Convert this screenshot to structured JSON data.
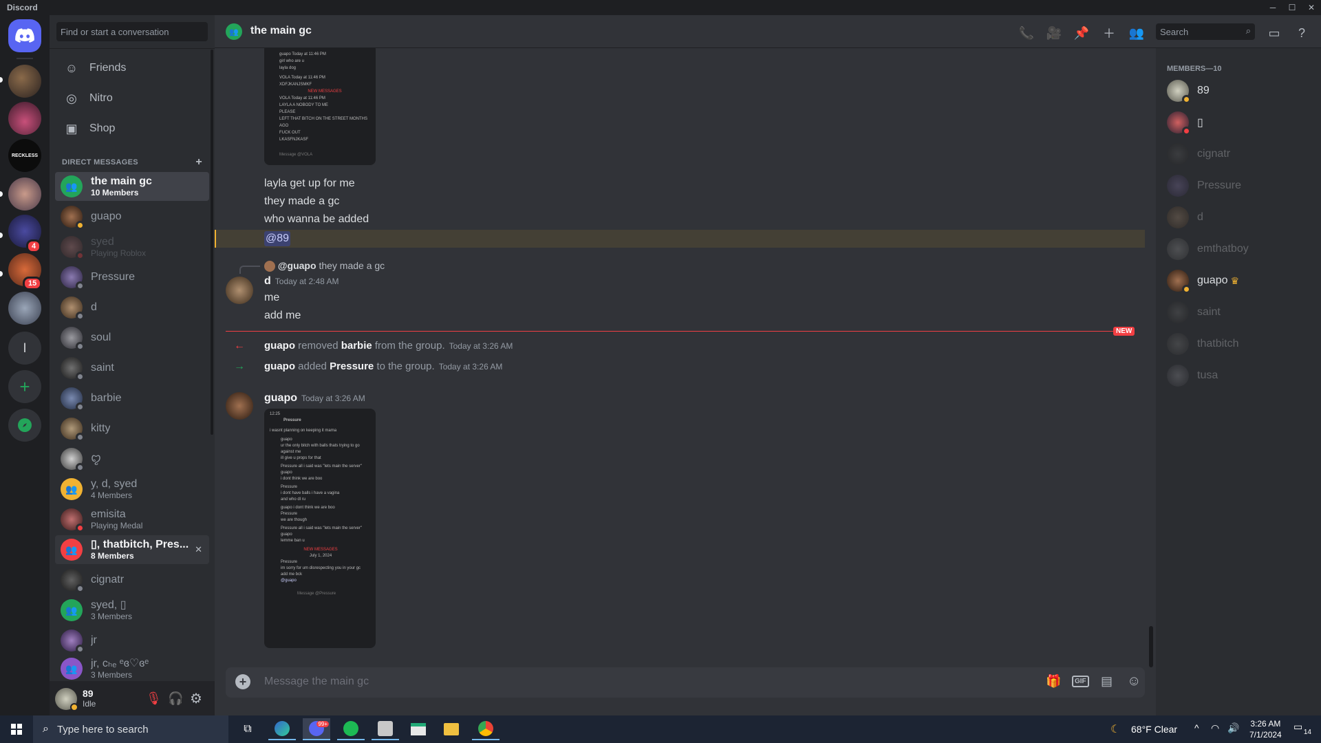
{
  "app": {
    "title": "Discord"
  },
  "search": {
    "dm_placeholder": "Find or start a conversation",
    "header_placeholder": "Search"
  },
  "nav": {
    "friends": "Friends",
    "nitro": "Nitro",
    "shop": "Shop"
  },
  "dm_section": {
    "title": "DIRECT MESSAGES",
    "add": "+"
  },
  "dms": [
    {
      "name": "the main gc",
      "sub": "10 Members"
    },
    {
      "name": "guapo",
      "sub": ""
    },
    {
      "name": "syed",
      "sub": "Playing Roblox"
    },
    {
      "name": "Pressure",
      "sub": ""
    },
    {
      "name": "d",
      "sub": ""
    },
    {
      "name": "soul",
      "sub": ""
    },
    {
      "name": "saint",
      "sub": ""
    },
    {
      "name": "barbie",
      "sub": ""
    },
    {
      "name": "kitty",
      "sub": ""
    },
    {
      "name": "ꨄ",
      "sub": ""
    },
    {
      "name": "y, d, syed",
      "sub": "4 Members"
    },
    {
      "name": "emisita",
      "sub": "Playing Medal"
    },
    {
      "name": "▯, thatbitch, Pres...",
      "sub": "8 Members",
      "close": "✕"
    },
    {
      "name": "cignatr",
      "sub": ""
    },
    {
      "name": "syed, ▯",
      "sub": "3 Members"
    },
    {
      "name": "jr",
      "sub": ""
    },
    {
      "name": "jr, ᴄₕₑ ᵉɞ♡ɞᵉ",
      "sub": "3 Members"
    }
  ],
  "servers": {
    "badges": [
      "4",
      "15"
    ],
    "letter": "l",
    "plus": "+"
  },
  "user": {
    "name": "89",
    "status": "Idle"
  },
  "header": {
    "channel": "the main gc"
  },
  "chat": {
    "lines1": [
      "layla get up for me",
      "they made a gc",
      "who wanna be added"
    ],
    "mention": "@89",
    "reply": {
      "author": "@guapo",
      "text": "they made a gc"
    },
    "msg_d": {
      "author": "d",
      "time": "Today at 2:48 AM",
      "lines": [
        "me",
        "add me"
      ]
    },
    "new_label": "NEW",
    "system": [
      {
        "actor": "guapo",
        "action": "removed",
        "target": "barbie",
        "rest": "from the group.",
        "time": "Today at 3:26 AM"
      },
      {
        "actor": "guapo",
        "action": "added",
        "target": "Pressure",
        "rest": "to the group.",
        "time": "Today at 3:26 AM"
      }
    ],
    "msg_guapo": {
      "author": "guapo",
      "time": "Today at 3:26 AM"
    },
    "shot1": {
      "lines": [
        "guapo  Today at 11:46 PM",
        "girl who are u",
        "layla dog",
        "VOLA  Today at 11:46 PM",
        "XDFJKANJSMKF",
        "NEW MESSAGES",
        "VOLA  Today at 11:46 PM",
        "LAYLA A NOBODY TO ME",
        "PLEASE",
        "LEFT THAT BITCH ON THE STREET MONTHS AGO",
        "FUCK OUT",
        "LKASFNJKASF",
        "Message @VOLA"
      ]
    },
    "shot2": {
      "lines": [
        "12:25",
        "Pressure",
        "i wasnt planning on keeping it mama",
        "guapo",
        "ur the only bitch with balls thats trying to go",
        "against me",
        "ill give u props for that",
        "Pressure  all i said was \"lets main the server\"",
        "guapo",
        "i dont think we are boo",
        "Pressure",
        "i dont have balls i have a vagina",
        "and who dl ru",
        "guapo i dont think we are boo",
        "Pressure",
        "we are though",
        "Pressure  all i said was \"lets main the server\"",
        "guapo",
        "lemme ban u",
        "NEW MESSAGES",
        "July 1, 2024",
        "Pressure",
        "im sorry for um disrespecting you in your gc",
        "add me bck",
        "@guapo",
        "Message @Pressure"
      ]
    },
    "input_placeholder": "Message the main gc"
  },
  "members": {
    "title": "MEMBERS—10",
    "list": [
      {
        "name": "89"
      },
      {
        "name": "▯"
      },
      {
        "name": "cignatr"
      },
      {
        "name": "Pressure"
      },
      {
        "name": "d"
      },
      {
        "name": "emthatboy"
      },
      {
        "name": "guapo",
        "crown": "♛"
      },
      {
        "name": "saint"
      },
      {
        "name": "thatbitch"
      },
      {
        "name": "tusa"
      }
    ]
  },
  "taskbar": {
    "search": "Type here to search",
    "weather": "68°F  Clear",
    "time": "3:26 AM",
    "date": "7/1/2024",
    "notif": "14",
    "discord_badge": "99+"
  }
}
